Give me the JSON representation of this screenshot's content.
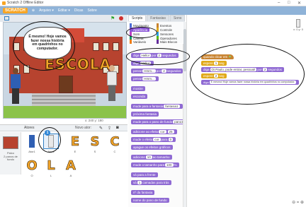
{
  "window": {
    "title": "Scratch 2 Offline Editor",
    "controls": [
      "–",
      "□",
      "✕"
    ]
  },
  "menubar": {
    "logo": "SCRATCH",
    "items": [
      "Arquivo ▾",
      "Editar ▾",
      "Dicas",
      "Sobre"
    ]
  },
  "stage": {
    "speech": "É mesmo! Hoje vamos fazer nossa história em quadrinhos no computador.",
    "banner": "ESCOLA",
    "coords": "x: 240  y: 180"
  },
  "sprites_pane": {
    "header": "Atores",
    "new_sprite_label": "Novo ator:",
    "stage_label": "Palco",
    "stage_sublabel": "2 panos de fundo",
    "selected_number": "1",
    "sprites": [
      {
        "glyph": "",
        "name": "Ator1"
      },
      {
        "glyph": "",
        "name": "Ator2"
      },
      {
        "glyph": "E",
        "name": "E"
      },
      {
        "glyph": "S",
        "name": "S"
      },
      {
        "glyph": "C",
        "name": "C"
      },
      {
        "glyph": "O",
        "name": "O"
      },
      {
        "glyph": "L",
        "name": "L"
      },
      {
        "glyph": "A",
        "name": "A"
      }
    ]
  },
  "tabs": [
    "Scripts",
    "Fantasias",
    "Sons"
  ],
  "categories": [
    {
      "label": "Movimento",
      "color": "#4a6cd4"
    },
    {
      "label": "Eventos",
      "color": "#c88330"
    },
    {
      "label": "Aparência",
      "color": "#8a55d7"
    },
    {
      "label": "Controle",
      "color": "#e1a91a"
    },
    {
      "label": "Som",
      "color": "#bb42c3"
    },
    {
      "label": "Sensores",
      "color": "#2ca5e2"
    },
    {
      "label": "Caneta",
      "color": "#0e9a6c"
    },
    {
      "label": "Operadores",
      "color": "#5cb712"
    },
    {
      "label": "Variáveis",
      "color": "#ee7d16"
    },
    {
      "label": "Mais Blocos",
      "color": "#632d99"
    }
  ],
  "palette": {
    "selected_category": "Aparência",
    "blocks": [
      {
        "pre": "diga",
        "slot": "Hello!",
        "mid": "por",
        "slot2": "2",
        "post": "segundos"
      },
      {
        "pre": "diga",
        "slot": "Hello!",
        "mid": "",
        "slot2": "",
        "post": ""
      },
      {
        "pre": "pense",
        "slot": "Hmm...",
        "mid": "por",
        "slot2": "2",
        "post": "segundos"
      },
      {
        "pre": "pense",
        "slot": "Hmm...",
        "mid": "",
        "slot2": "",
        "post": ""
      },
      {
        "pre": "mostre",
        "slot": "",
        "mid": "",
        "slot2": "",
        "post": ""
      },
      {
        "pre": "esconda",
        "slot": "",
        "mid": "",
        "slot2": "",
        "post": ""
      },
      {
        "pre": "mude para a fantasia",
        "slot": "fantasia1",
        "mid": "",
        "slot2": "",
        "post": ""
      },
      {
        "pre": "próxima fantasia",
        "slot": "",
        "mid": "",
        "slot2": "",
        "post": ""
      },
      {
        "pre": "mude para o pano de fundo",
        "slot": "pano1",
        "mid": "",
        "slot2": "",
        "post": ""
      },
      {
        "pre": "adicione ao efeito",
        "slot": "cor",
        "mid": "",
        "slot2": "25",
        "post": ""
      },
      {
        "pre": "mude o efeito",
        "slot": "cor",
        "mid": "para",
        "slot2": "0",
        "post": ""
      },
      {
        "pre": "apague os efeitos gráficos",
        "slot": "",
        "mid": "",
        "slot2": "",
        "post": ""
      },
      {
        "pre": "adicione",
        "slot": "10",
        "mid": "ao tamanho",
        "slot2": "",
        "post": ""
      },
      {
        "pre": "mude o tamanho para",
        "slot": "100",
        "mid": "%",
        "slot2": "",
        "post": ""
      },
      {
        "pre": "vá para a frente",
        "slot": "",
        "mid": "",
        "slot2": "",
        "post": ""
      },
      {
        "pre": "vá",
        "slot": "1",
        "mid": "camadas para trás",
        "slot2": "",
        "post": ""
      },
      {
        "pre": "nº da fantasia",
        "slot": "",
        "mid": "",
        "slot2": "",
        "post": ""
      },
      {
        "pre": "nome do pano de fundo",
        "slot": "",
        "mid": "",
        "slot2": "",
        "post": ""
      }
    ]
  },
  "scripts": {
    "sprite_xy": "x: 0 y: 0",
    "blocks": [
      {
        "kind": "event",
        "text": "quando clicar em",
        "flag": "⚑"
      },
      {
        "kind": "control",
        "text": "espere",
        "slot": "1",
        "post": "seg"
      },
      {
        "kind": "looks",
        "text": "diga",
        "slot": "Oi Paulo, pode entrar, pessoal!",
        "mid": "por",
        "slot2": "2",
        "post": "segundos"
      },
      {
        "kind": "control",
        "text": "espere",
        "slot": "2",
        "post": "seg"
      },
      {
        "kind": "looks",
        "text": "diga",
        "slot": "É mesmo! Hoje vamos fazer nossa história em quadrinhos no computador.",
        "mid": "",
        "slot2": "",
        "post": ""
      }
    ],
    "zoom_controls": "⊖ = ⊕"
  },
  "colors": {
    "looks": "#8f6ad3",
    "event": "#c88330",
    "control": "#e1a91a",
    "menubar": "#8fb3d8",
    "logo": "#f7a524"
  }
}
